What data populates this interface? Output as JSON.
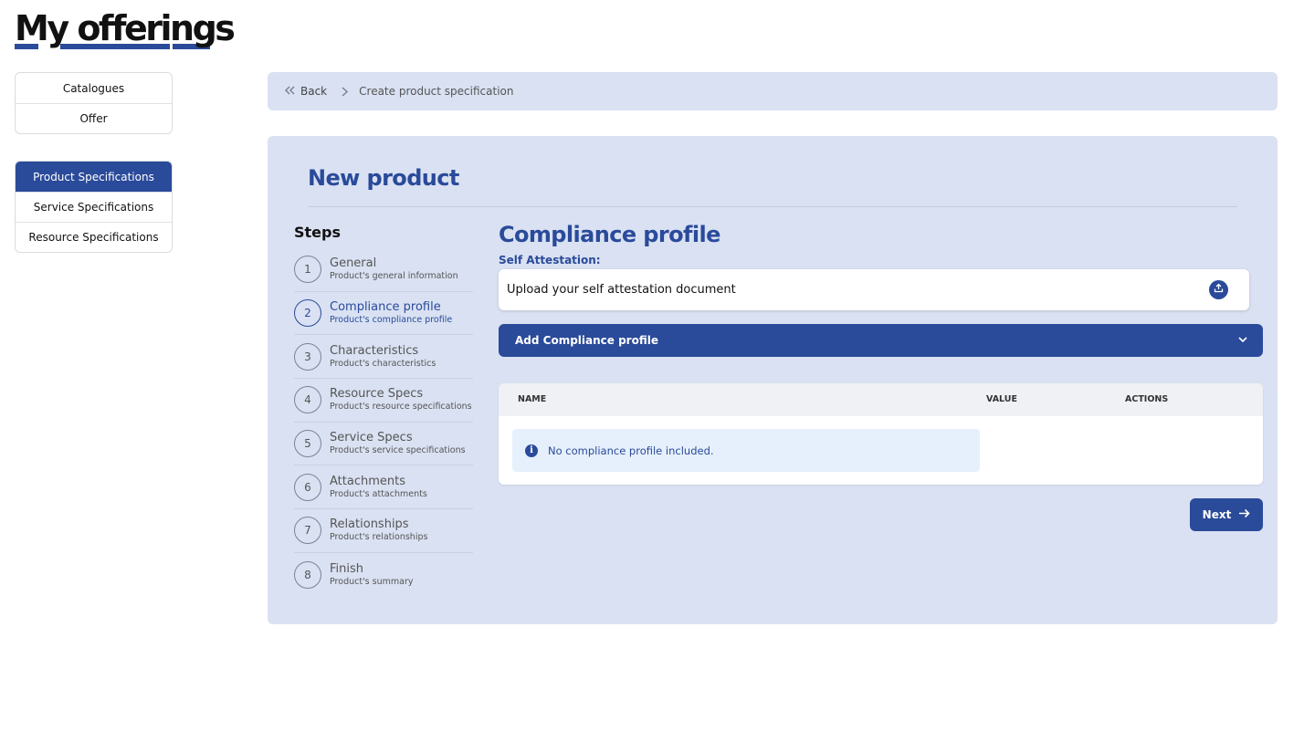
{
  "page": {
    "title_words": [
      "My",
      "offerings"
    ]
  },
  "nav": {
    "group1": [
      {
        "label": "Catalogues"
      },
      {
        "label": "Offer"
      }
    ],
    "group2": [
      {
        "label": "Product Specifications",
        "active": true
      },
      {
        "label": "Service Specifications"
      },
      {
        "label": "Resource Specifications"
      }
    ]
  },
  "breadcrumb": {
    "back_label": "Back",
    "current": "Create product specification"
  },
  "panel": {
    "title": "New product",
    "steps_title": "Steps",
    "steps": [
      {
        "num": "1",
        "label": "General",
        "sub": "Product's general information"
      },
      {
        "num": "2",
        "label": "Compliance profile",
        "sub": "Product's compliance profile",
        "active": true
      },
      {
        "num": "3",
        "label": "Characteristics",
        "sub": "Product's characteristics"
      },
      {
        "num": "4",
        "label": "Resource Specs",
        "sub": "Product's resource specifications"
      },
      {
        "num": "5",
        "label": "Service Specs",
        "sub": "Product's service specifications"
      },
      {
        "num": "6",
        "label": "Attachments",
        "sub": "Product's attachments"
      },
      {
        "num": "7",
        "label": "Relationships",
        "sub": "Product's relationships"
      },
      {
        "num": "8",
        "label": "Finish",
        "sub": "Product's summary"
      }
    ]
  },
  "content": {
    "title": "Compliance profile",
    "self_attestation_label": "Self Attestation:",
    "upload_text": "Upload your self attestation document",
    "accordion_label": "Add Compliance profile",
    "table": {
      "columns": [
        "NAME",
        "VALUE",
        "ACTIONS"
      ],
      "empty_message": "No compliance profile included."
    },
    "next_label": "Next"
  },
  "colors": {
    "primary": "#2a4a9a",
    "panel_bg": "#d9e1f2",
    "info_bg": "#e6f0fc"
  }
}
